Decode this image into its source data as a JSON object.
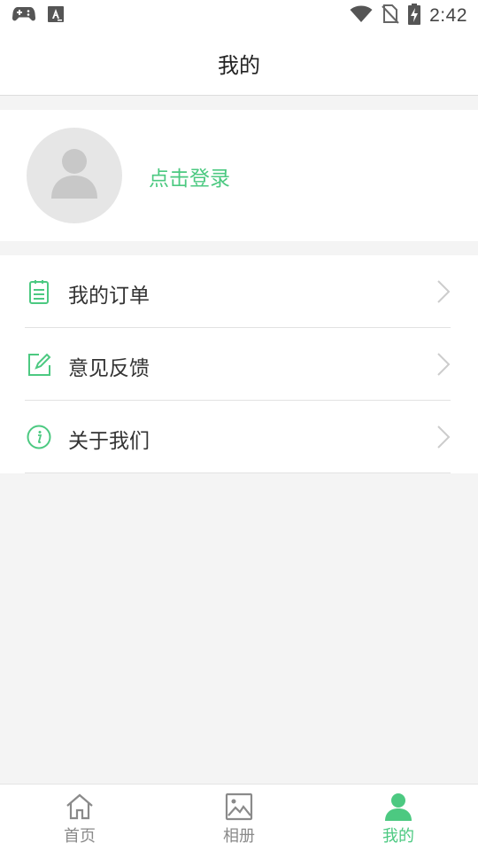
{
  "status_bar": {
    "time": "2:42",
    "left_icons": [
      "gamepad-icon",
      "font-a-icon"
    ],
    "right_icons": [
      "wifi-icon",
      "no-sim-icon",
      "battery-charging-icon"
    ]
  },
  "header": {
    "title": "我的"
  },
  "profile": {
    "login_label": "点击登录",
    "avatar_icon": "person-avatar-icon"
  },
  "menu": {
    "items": [
      {
        "label": "我的订单",
        "icon": "clipboard-list-icon"
      },
      {
        "label": "意见反馈",
        "icon": "edit-square-icon"
      },
      {
        "label": "关于我们",
        "icon": "info-circle-icon"
      }
    ]
  },
  "tabbar": {
    "tabs": [
      {
        "label": "首页",
        "icon": "home-icon",
        "active": false
      },
      {
        "label": "相册",
        "icon": "image-icon",
        "active": false
      },
      {
        "label": "我的",
        "icon": "person-icon",
        "active": true
      }
    ]
  },
  "colors": {
    "accent": "#4cc981",
    "background": "#f4f4f4",
    "text": "#333333",
    "inactive_tab": "#8a8a8a"
  }
}
